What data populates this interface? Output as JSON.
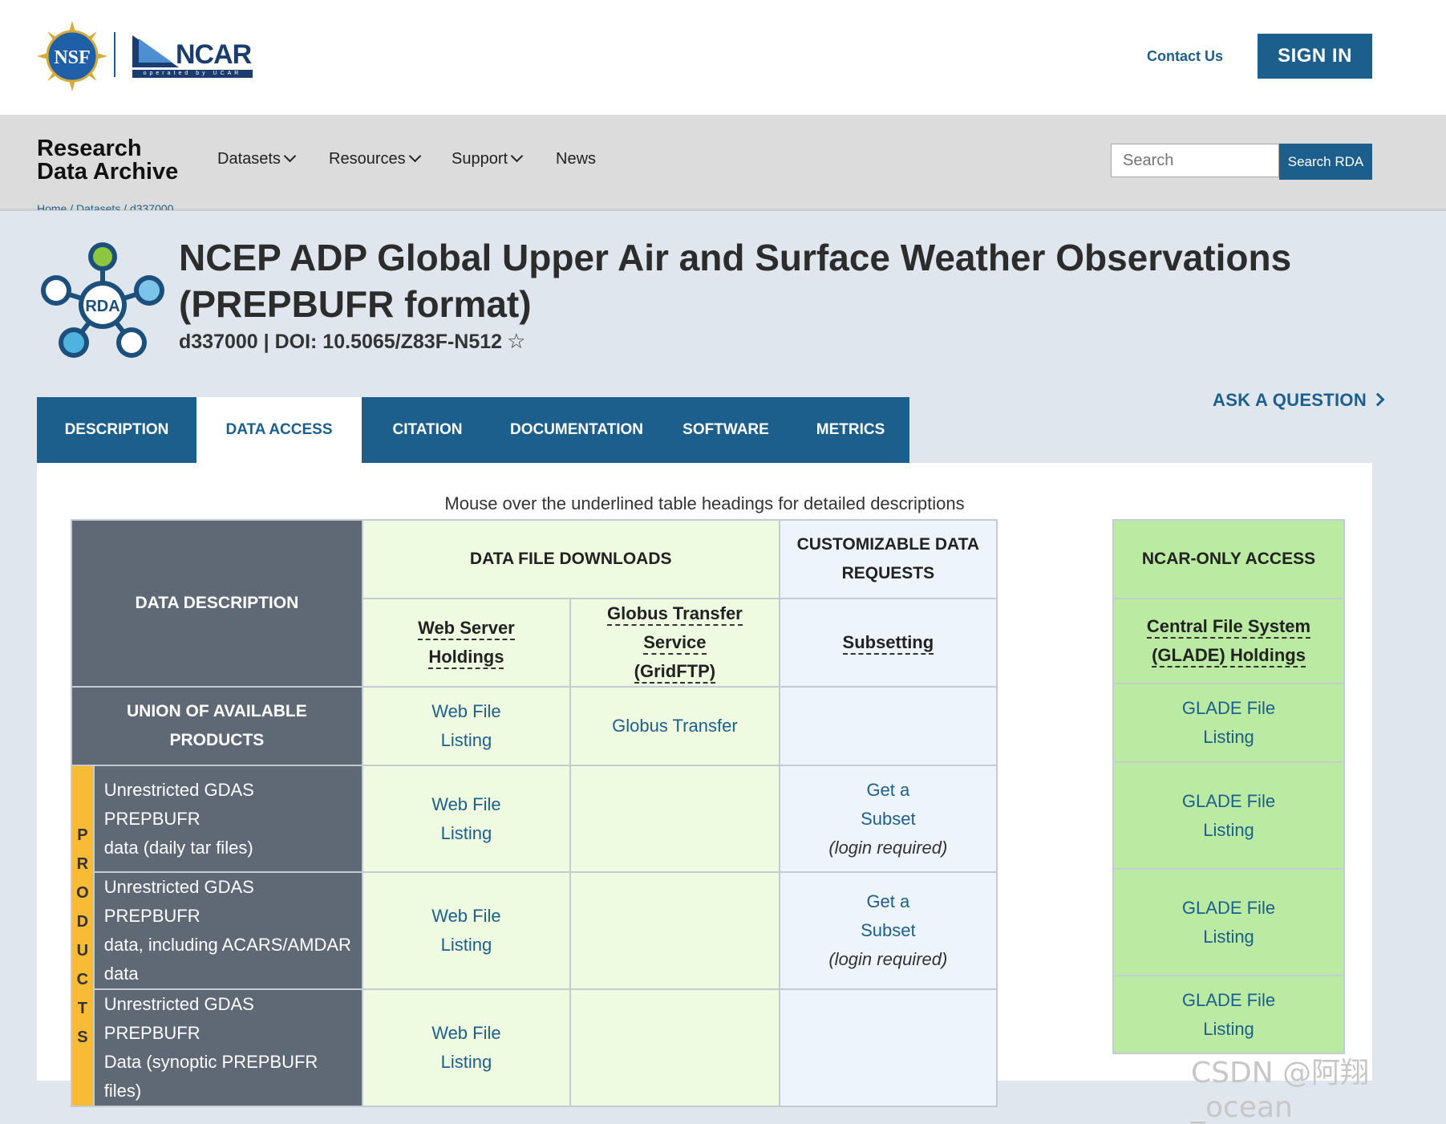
{
  "header": {
    "logo_nsf": "NSF",
    "logo_ncar": "NCAR",
    "logo_ncar_sub": "operated by UCAR",
    "contact_label": "Contact Us",
    "signin_label": "SIGN IN"
  },
  "nav": {
    "brand_line1": "Research",
    "brand_line2": "Data Archive",
    "items": [
      {
        "label": "Datasets",
        "dropdown": true
      },
      {
        "label": "Resources",
        "dropdown": true
      },
      {
        "label": "Support",
        "dropdown": true
      },
      {
        "label": "News",
        "dropdown": false
      }
    ],
    "search_placeholder": "Search",
    "search_button": "Search RDA"
  },
  "breadcrumb": [
    "Home",
    "Datasets",
    "d337000"
  ],
  "dataset": {
    "icon_label": "RDA",
    "title_line1": "NCEP ADP Global Upper Air and Surface Weather Observations",
    "title_line2": "(PREPBUFR format)",
    "id_doi": "d337000 | DOI: 10.5065/Z83F-N512"
  },
  "ask_question": "ASK A QUESTION",
  "tabs": [
    {
      "label": "DESCRIPTION",
      "active": false
    },
    {
      "label": "DATA ACCESS",
      "active": true
    },
    {
      "label": "CITATION",
      "active": false
    },
    {
      "label": "DOCUMENTATION",
      "active": false
    },
    {
      "label": "SOFTWARE",
      "active": false
    },
    {
      "label": "METRICS",
      "active": false
    }
  ],
  "table": {
    "hint": "Mouse over the underlined table headings for detailed descriptions",
    "col_data_description": "DATA DESCRIPTION",
    "col_data_file_downloads": "DATA FILE DOWNLOADS",
    "col_custom_line1": "CUSTOMIZABLE DATA",
    "col_custom_line2": "REQUESTS",
    "col_ncar_only": "NCAR-ONLY ACCESS",
    "sub_web_server_1": "Web Server",
    "sub_web_server_2": "Holdings",
    "sub_globus_1": "Globus Transfer Service",
    "sub_globus_2": "(GridFTP)",
    "sub_subsetting": "Subsetting",
    "sub_glade_1": "Central File System",
    "sub_glade_2": "(GLADE) Holdings",
    "union_label": "UNION OF AVAILABLE PRODUCTS",
    "products_side": [
      "P",
      "R",
      "O",
      "D",
      "U",
      "C",
      "T",
      "S"
    ],
    "links": {
      "web_file_1": "Web File",
      "web_file_2": "Listing",
      "globus": "Globus Transfer",
      "glade_1": "GLADE File",
      "glade_2": "Listing",
      "subset_1": "Get a",
      "subset_2": "Subset",
      "subset_note": "(login required)"
    },
    "products": [
      {
        "line1": "Unrestricted GDAS PREPBUFR",
        "line2": "data (daily tar files)",
        "line3": ""
      },
      {
        "line1": "Unrestricted GDAS PREPBUFR",
        "line2": "data, including ACARS/AMDAR",
        "line3": "data"
      },
      {
        "line1": "Unrestricted GDAS PREPBUFR",
        "line2": "Data (synoptic PREPBUFR files)",
        "line3": ""
      }
    ]
  },
  "watermark": "CSDN @阿翔_ocean",
  "colors": {
    "primary": "#1d5f8c",
    "dark_cell": "#5f6875",
    "light_green": "#effbe1",
    "light_blue": "#eef4fc",
    "green": "#bbeaa3",
    "products_bar": "#f7bb36"
  }
}
